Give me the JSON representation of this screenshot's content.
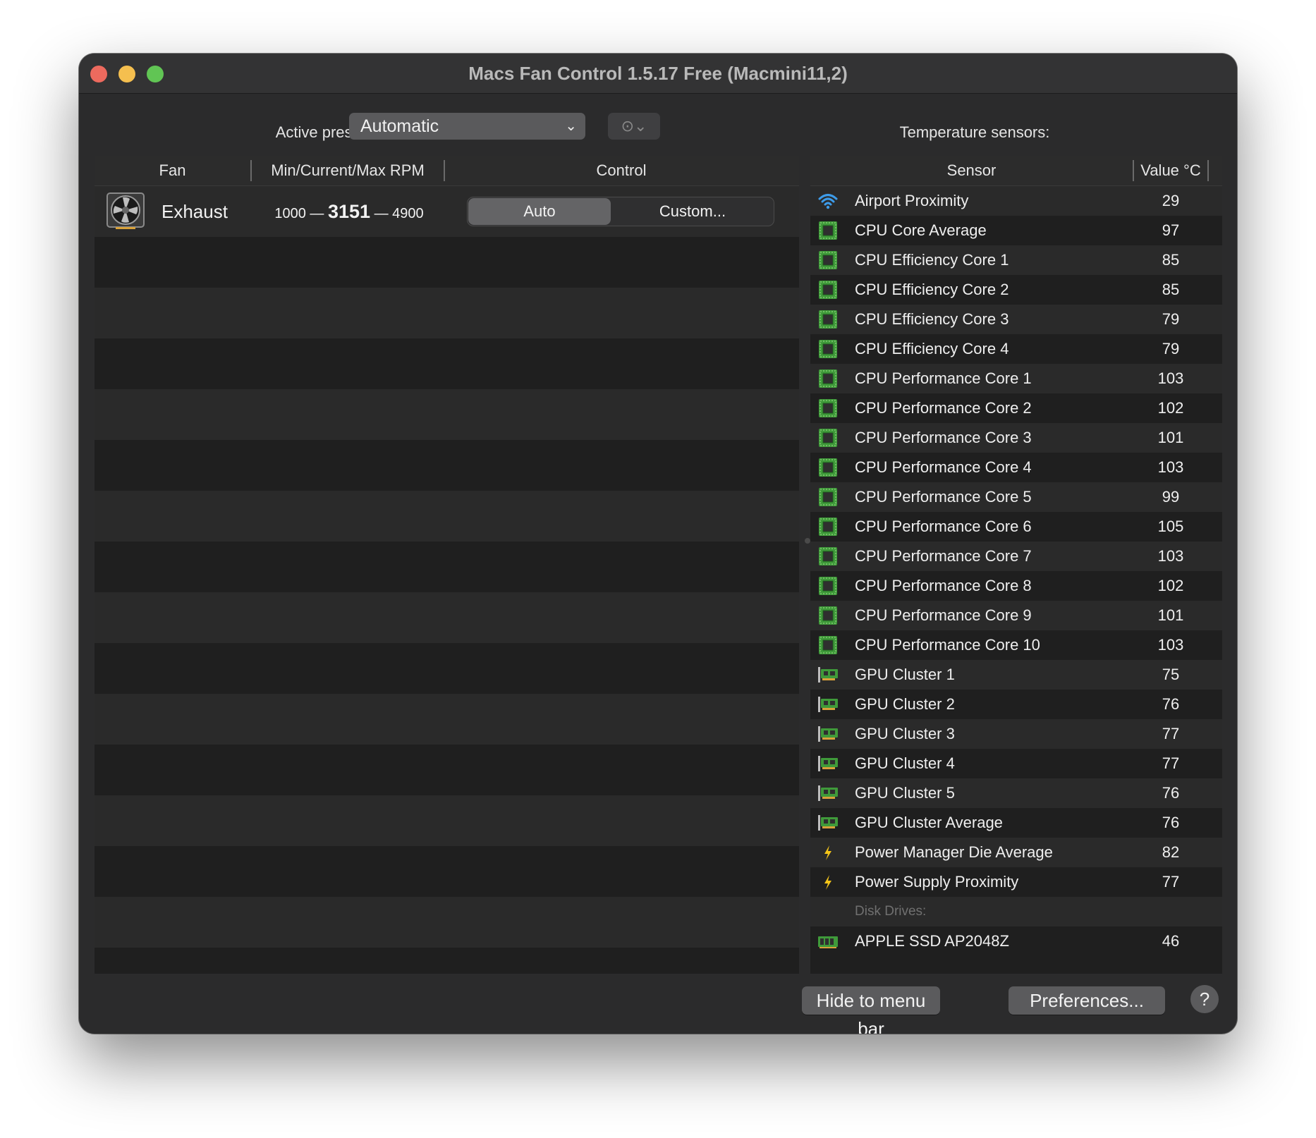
{
  "window": {
    "title": "Macs Fan Control 1.5.17 Free (Macmini11,2)"
  },
  "preset": {
    "label": "Active preset:",
    "selected": "Automatic",
    "more_icon": "ellipsis-circle-icon"
  },
  "fans": {
    "columns": [
      "Fan",
      "Min/Current/Max RPM",
      "Control"
    ],
    "items": [
      {
        "name": "Exhaust",
        "min": "1000",
        "current": "3151",
        "max": "4900",
        "separator": "—",
        "control_auto": "Auto",
        "control_custom": "Custom...",
        "icon": "fan-icon"
      }
    ]
  },
  "sensors": {
    "label": "Temperature sensors:",
    "columns": [
      "Sensor",
      "Value °C"
    ],
    "items": [
      {
        "name": "Airport Proximity",
        "value": "29",
        "icon": "wifi"
      },
      {
        "name": "CPU Core Average",
        "value": "97",
        "icon": "chip"
      },
      {
        "name": "CPU Efficiency Core 1",
        "value": "85",
        "icon": "chip"
      },
      {
        "name": "CPU Efficiency Core 2",
        "value": "85",
        "icon": "chip"
      },
      {
        "name": "CPU Efficiency Core 3",
        "value": "79",
        "icon": "chip"
      },
      {
        "name": "CPU Efficiency Core 4",
        "value": "79",
        "icon": "chip"
      },
      {
        "name": "CPU Performance Core 1",
        "value": "103",
        "icon": "chip"
      },
      {
        "name": "CPU Performance Core 2",
        "value": "102",
        "icon": "chip"
      },
      {
        "name": "CPU Performance Core 3",
        "value": "101",
        "icon": "chip"
      },
      {
        "name": "CPU Performance Core 4",
        "value": "103",
        "icon": "chip"
      },
      {
        "name": "CPU Performance Core 5",
        "value": "99",
        "icon": "chip"
      },
      {
        "name": "CPU Performance Core 6",
        "value": "105",
        "icon": "chip"
      },
      {
        "name": "CPU Performance Core 7",
        "value": "103",
        "icon": "chip"
      },
      {
        "name": "CPU Performance Core 8",
        "value": "102",
        "icon": "chip"
      },
      {
        "name": "CPU Performance Core 9",
        "value": "101",
        "icon": "chip"
      },
      {
        "name": "CPU Performance Core 10",
        "value": "103",
        "icon": "chip"
      },
      {
        "name": "GPU Cluster 1",
        "value": "75",
        "icon": "gpu"
      },
      {
        "name": "GPU Cluster 2",
        "value": "76",
        "icon": "gpu"
      },
      {
        "name": "GPU Cluster 3",
        "value": "77",
        "icon": "gpu"
      },
      {
        "name": "GPU Cluster 4",
        "value": "77",
        "icon": "gpu"
      },
      {
        "name": "GPU Cluster 5",
        "value": "76",
        "icon": "gpu"
      },
      {
        "name": "GPU Cluster Average",
        "value": "76",
        "icon": "gpu"
      },
      {
        "name": "Power Manager Die Average",
        "value": "82",
        "icon": "bolt"
      },
      {
        "name": "Power Supply Proximity",
        "value": "77",
        "icon": "bolt"
      },
      {
        "name": "Disk Drives:",
        "value": "",
        "icon": "",
        "group": true
      },
      {
        "name": "APPLE SSD AP2048Z",
        "value": "46",
        "icon": "ssd"
      }
    ]
  },
  "footer": {
    "hide_label": "Hide to menu bar",
    "prefs_label": "Preferences...",
    "help_label": "?"
  },
  "colors": {
    "window_bg": "#2b2b2c",
    "chip_green": "#3f9a3a",
    "wifi_blue": "#3d9be9",
    "bolt_yellow": "#f5c518"
  }
}
